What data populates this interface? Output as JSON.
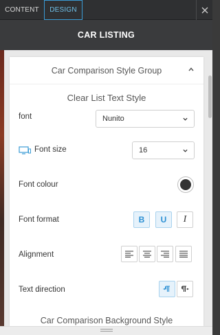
{
  "tabs": {
    "content": "CONTENT",
    "design": "DESIGN",
    "active": "design"
  },
  "header": {
    "title": "CAR LISTING"
  },
  "group": {
    "title": "Car Comparison Style Group"
  },
  "section": {
    "title": "Clear List Text Style"
  },
  "rows": {
    "font": {
      "label": "font",
      "value": "Nunito"
    },
    "font_size": {
      "label": "Font size",
      "value": "16"
    },
    "font_colour": {
      "label": "Font colour",
      "color": "#333333"
    },
    "font_format": {
      "label": "Font format",
      "buttons": [
        "B",
        "U",
        "I"
      ],
      "active": [
        "B",
        "U"
      ]
    },
    "alignment": {
      "label": "Alignment",
      "options": [
        "left",
        "center",
        "right",
        "justify"
      ]
    },
    "text_direction": {
      "label": "Text direction",
      "options": [
        "ltr",
        "rtl"
      ],
      "active": "ltr"
    }
  },
  "next_group": {
    "title": "Car Comparison Background Style"
  },
  "colors": {
    "accent": "#3a9bd5",
    "active_bg": "#e6f2fb",
    "tab_bar": "#2f3032",
    "title_bar": "#3a3b3d"
  }
}
